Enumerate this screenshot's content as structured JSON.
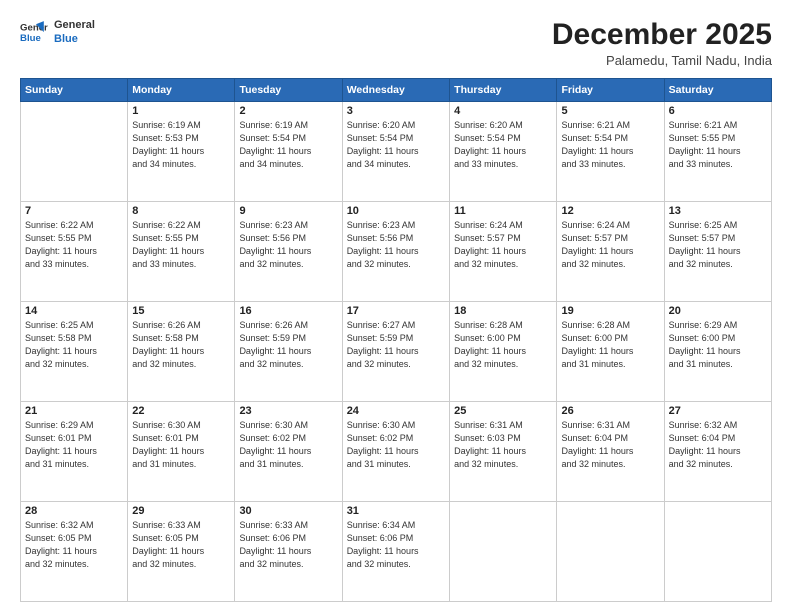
{
  "header": {
    "logo_general": "General",
    "logo_blue": "Blue",
    "month": "December 2025",
    "location": "Palamedu, Tamil Nadu, India"
  },
  "days_of_week": [
    "Sunday",
    "Monday",
    "Tuesday",
    "Wednesday",
    "Thursday",
    "Friday",
    "Saturday"
  ],
  "weeks": [
    [
      {
        "day": "",
        "info": ""
      },
      {
        "day": "1",
        "info": "Sunrise: 6:19 AM\nSunset: 5:53 PM\nDaylight: 11 hours\nand 34 minutes."
      },
      {
        "day": "2",
        "info": "Sunrise: 6:19 AM\nSunset: 5:54 PM\nDaylight: 11 hours\nand 34 minutes."
      },
      {
        "day": "3",
        "info": "Sunrise: 6:20 AM\nSunset: 5:54 PM\nDaylight: 11 hours\nand 34 minutes."
      },
      {
        "day": "4",
        "info": "Sunrise: 6:20 AM\nSunset: 5:54 PM\nDaylight: 11 hours\nand 33 minutes."
      },
      {
        "day": "5",
        "info": "Sunrise: 6:21 AM\nSunset: 5:54 PM\nDaylight: 11 hours\nand 33 minutes."
      },
      {
        "day": "6",
        "info": "Sunrise: 6:21 AM\nSunset: 5:55 PM\nDaylight: 11 hours\nand 33 minutes."
      }
    ],
    [
      {
        "day": "7",
        "info": "Sunrise: 6:22 AM\nSunset: 5:55 PM\nDaylight: 11 hours\nand 33 minutes."
      },
      {
        "day": "8",
        "info": "Sunrise: 6:22 AM\nSunset: 5:55 PM\nDaylight: 11 hours\nand 33 minutes."
      },
      {
        "day": "9",
        "info": "Sunrise: 6:23 AM\nSunset: 5:56 PM\nDaylight: 11 hours\nand 32 minutes."
      },
      {
        "day": "10",
        "info": "Sunrise: 6:23 AM\nSunset: 5:56 PM\nDaylight: 11 hours\nand 32 minutes."
      },
      {
        "day": "11",
        "info": "Sunrise: 6:24 AM\nSunset: 5:57 PM\nDaylight: 11 hours\nand 32 minutes."
      },
      {
        "day": "12",
        "info": "Sunrise: 6:24 AM\nSunset: 5:57 PM\nDaylight: 11 hours\nand 32 minutes."
      },
      {
        "day": "13",
        "info": "Sunrise: 6:25 AM\nSunset: 5:57 PM\nDaylight: 11 hours\nand 32 minutes."
      }
    ],
    [
      {
        "day": "14",
        "info": "Sunrise: 6:25 AM\nSunset: 5:58 PM\nDaylight: 11 hours\nand 32 minutes."
      },
      {
        "day": "15",
        "info": "Sunrise: 6:26 AM\nSunset: 5:58 PM\nDaylight: 11 hours\nand 32 minutes."
      },
      {
        "day": "16",
        "info": "Sunrise: 6:26 AM\nSunset: 5:59 PM\nDaylight: 11 hours\nand 32 minutes."
      },
      {
        "day": "17",
        "info": "Sunrise: 6:27 AM\nSunset: 5:59 PM\nDaylight: 11 hours\nand 32 minutes."
      },
      {
        "day": "18",
        "info": "Sunrise: 6:28 AM\nSunset: 6:00 PM\nDaylight: 11 hours\nand 32 minutes."
      },
      {
        "day": "19",
        "info": "Sunrise: 6:28 AM\nSunset: 6:00 PM\nDaylight: 11 hours\nand 31 minutes."
      },
      {
        "day": "20",
        "info": "Sunrise: 6:29 AM\nSunset: 6:00 PM\nDaylight: 11 hours\nand 31 minutes."
      }
    ],
    [
      {
        "day": "21",
        "info": "Sunrise: 6:29 AM\nSunset: 6:01 PM\nDaylight: 11 hours\nand 31 minutes."
      },
      {
        "day": "22",
        "info": "Sunrise: 6:30 AM\nSunset: 6:01 PM\nDaylight: 11 hours\nand 31 minutes."
      },
      {
        "day": "23",
        "info": "Sunrise: 6:30 AM\nSunset: 6:02 PM\nDaylight: 11 hours\nand 31 minutes."
      },
      {
        "day": "24",
        "info": "Sunrise: 6:30 AM\nSunset: 6:02 PM\nDaylight: 11 hours\nand 31 minutes."
      },
      {
        "day": "25",
        "info": "Sunrise: 6:31 AM\nSunset: 6:03 PM\nDaylight: 11 hours\nand 32 minutes."
      },
      {
        "day": "26",
        "info": "Sunrise: 6:31 AM\nSunset: 6:04 PM\nDaylight: 11 hours\nand 32 minutes."
      },
      {
        "day": "27",
        "info": "Sunrise: 6:32 AM\nSunset: 6:04 PM\nDaylight: 11 hours\nand 32 minutes."
      }
    ],
    [
      {
        "day": "28",
        "info": "Sunrise: 6:32 AM\nSunset: 6:05 PM\nDaylight: 11 hours\nand 32 minutes."
      },
      {
        "day": "29",
        "info": "Sunrise: 6:33 AM\nSunset: 6:05 PM\nDaylight: 11 hours\nand 32 minutes."
      },
      {
        "day": "30",
        "info": "Sunrise: 6:33 AM\nSunset: 6:06 PM\nDaylight: 11 hours\nand 32 minutes."
      },
      {
        "day": "31",
        "info": "Sunrise: 6:34 AM\nSunset: 6:06 PM\nDaylight: 11 hours\nand 32 minutes."
      },
      {
        "day": "",
        "info": ""
      },
      {
        "day": "",
        "info": ""
      },
      {
        "day": "",
        "info": ""
      }
    ]
  ]
}
